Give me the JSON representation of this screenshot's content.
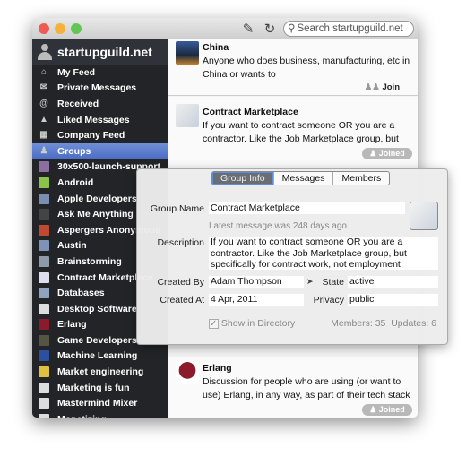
{
  "window": {
    "traffic_lights": {
      "close": "#ee5b53",
      "minimize": "#f4b23c",
      "zoom": "#62c655"
    }
  },
  "toolbar": {
    "compose_icon": "compose-icon",
    "refresh_icon": "refresh-icon",
    "search_placeholder": "Search startupguild.net"
  },
  "sidebar": {
    "title": "startupguild.net",
    "items": [
      {
        "label": "My Feed",
        "icon": "home-icon",
        "color": "#999"
      },
      {
        "label": "Private Messages",
        "icon": "envelope-icon",
        "color": "#999"
      },
      {
        "label": "Received",
        "icon": "at-icon",
        "color": "#999"
      },
      {
        "label": "Liked Messages",
        "icon": "thumbs-up-icon",
        "color": "#999"
      },
      {
        "label": "Company Feed",
        "icon": "building-icon",
        "color": "#999"
      },
      {
        "label": "Groups",
        "icon": "group-icon",
        "color": "#aab",
        "selected": true
      },
      {
        "label": "30x500-launch-support",
        "icon": "group-avatar",
        "color": "#8a6fa0"
      },
      {
        "label": "Android",
        "icon": "group-avatar",
        "color": "#8bc34a"
      },
      {
        "label": "Apple Developers",
        "icon": "group-avatar",
        "color": "#7a8fb0"
      },
      {
        "label": "Ask Me Anything",
        "icon": "group-avatar",
        "color": "#444"
      },
      {
        "label": "Aspergers Anonymous",
        "icon": "group-avatar",
        "color": "#c04a30"
      },
      {
        "label": "Austin",
        "icon": "group-avatar",
        "color": "#7d94b8"
      },
      {
        "label": "Brainstorming",
        "icon": "group-avatar",
        "color": "#8d9aa8"
      },
      {
        "label": "Contract Marketplace",
        "icon": "group-avatar",
        "color": "#dde"
      },
      {
        "label": "Databases",
        "icon": "group-avatar",
        "color": "#8fa3c0"
      },
      {
        "label": "Desktop Software",
        "icon": "group-avatar",
        "color": "#ddd"
      },
      {
        "label": "Erlang",
        "icon": "group-avatar",
        "color": "#8b1a2a"
      },
      {
        "label": "Game Developers",
        "icon": "group-avatar",
        "color": "#554"
      },
      {
        "label": "Machine Learning",
        "icon": "group-avatar",
        "color": "#2c4fa0"
      },
      {
        "label": "Market engineering",
        "icon": "group-avatar",
        "color": "#e0c040"
      },
      {
        "label": "Marketing is fun",
        "icon": "group-avatar",
        "color": "#ddd"
      },
      {
        "label": "Mastermind Mixer",
        "icon": "group-avatar",
        "color": "#ddd"
      },
      {
        "label": "Monetizing",
        "icon": "group-avatar",
        "color": "#ddd"
      }
    ]
  },
  "groups": [
    {
      "title": "China",
      "description": "Anyone who does business, manufacturing, etc in China or wants to",
      "action": "Join"
    },
    {
      "title": "Contract Marketplace",
      "description": "If you want to contract someone OR you are a contractor. Like the Job Marketplace group, but",
      "action": "Joined"
    },
    {
      "title": "Erlang",
      "description": "Discussion for people who are using (or want to use) Erlang, in any way, as part of their tech stack",
      "action": "Joined"
    }
  ],
  "popover": {
    "tabs": [
      "Group Info",
      "Messages",
      "Members"
    ],
    "active_tab": "Group Info",
    "group_name_label": "Group Name",
    "group_name": "Contract Marketplace",
    "latest": "Latest message was 248 days ago",
    "description_label": "Description",
    "description": "If you want to contract someone OR you are a contractor. Like the Job Marketplace group, but specifically for contract work, not employment",
    "created_by_label": "Created By",
    "created_by": "Adam Thompson",
    "state_label": "State",
    "state": "active",
    "created_at_label": "Created At",
    "created_at": "4 Apr, 2011",
    "privacy_label": "Privacy",
    "privacy": "public",
    "show_in_directory_label": "Show in Directory",
    "show_in_directory": true,
    "stats": "Members: 35  Updates: 6"
  }
}
